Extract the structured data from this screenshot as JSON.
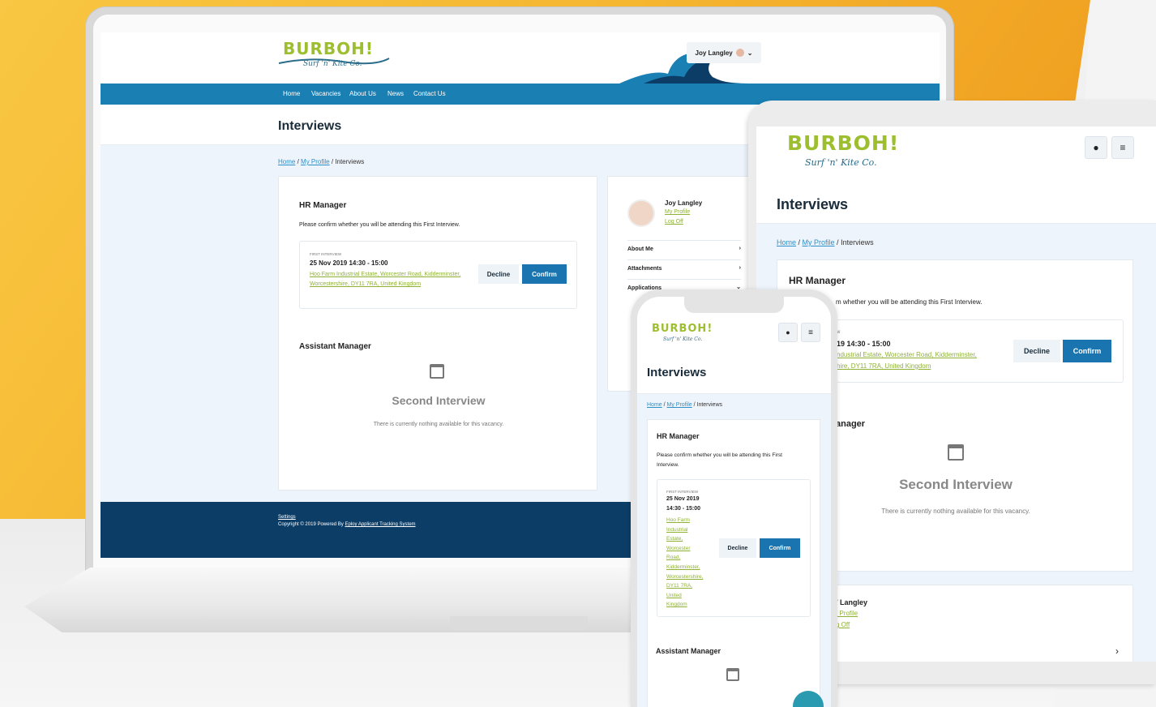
{
  "brand": {
    "name": "BURBOH!",
    "tagline": "Surf 'n' Kite Co."
  },
  "user": {
    "name": "Joy Langley",
    "my_profile": "My Profile",
    "log_off": "Log Off"
  },
  "nav": [
    "Home",
    "Vacancies",
    "About Us",
    "News",
    "Contact Us"
  ],
  "page": {
    "title": "Interviews"
  },
  "breadcrumb": {
    "home": "Home",
    "profile": "My Profile",
    "current": "Interviews",
    "sep": "/"
  },
  "interview1": {
    "job": "HR Manager",
    "prompt": "Please confirm whether you will be attending this First Interview.",
    "stage": "FIRST INTERVIEW",
    "datetime": "25 Nov 2019 14:30 - 15:00",
    "date": "25 Nov 2019",
    "time": "14:30 - 15:00",
    "address": "Hoo Farm Industrial Estate, Worcester Road, Kidderminster, Worcestershire, DY11 7RA, United Kingdom",
    "decline": "Decline",
    "confirm": "Confirm"
  },
  "interview2": {
    "job": "Assistant Manager",
    "heading": "Second Interview",
    "empty": "There is currently nothing available for this vacancy."
  },
  "sidebar": {
    "items": [
      "About Me",
      "Attachments",
      "Applications"
    ]
  },
  "footer": {
    "settings": "Settings",
    "copyright": "Copyright © 2019 Powered By",
    "powered": "Eploy Applicant Tracking System"
  },
  "tablet": {
    "job_partial": "HR Manager",
    "prompt_partial": "m whether you will be attending this First Interview.",
    "stage_partial": "w",
    "datetime_partial": "19 14:30 - 15:00",
    "address_line1": "ndustrial Estate, Worcester Road, Kidderminster,",
    "address_line2": "hire, DY11 7RA, United Kingdom",
    "job2_partial": "anager",
    "user_partial": "/ Langley",
    "profile_partial": "/ Profile",
    "logoff_partial": "g Off"
  },
  "phone": {
    "prompt_line1": "Please confirm whether you will be attending this First",
    "prompt_line2": "Interview.",
    "address_lines": [
      "Hoo Farm",
      "Industrial",
      "Estate,",
      "Worcester",
      "Road,",
      "Kidderminster,",
      "Worcestershire,",
      "DY11 7RA,",
      "United",
      "Kingdom"
    ]
  },
  "colors": {
    "accent": "#1a74b0",
    "nav": "#1a7fb3",
    "footer": "#0b3d66",
    "brand_green": "#9dbf2f",
    "link_green": "#8fb136"
  }
}
